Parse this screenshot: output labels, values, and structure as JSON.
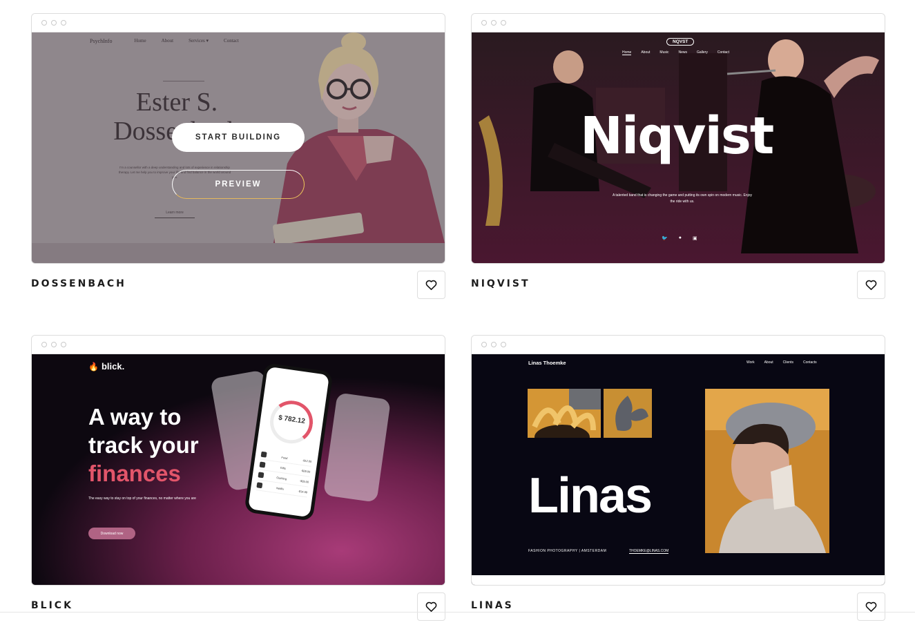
{
  "hover_actions": {
    "start_label": "START BUILDING",
    "preview_label": "PREVIEW"
  },
  "cards": [
    {
      "title": "DOSSENBACH",
      "preview": {
        "logo": "PsychInfo",
        "nav": [
          "Home",
          "About",
          "Services ▾",
          "Contact"
        ],
        "name_line1": "Ester S.",
        "name_line2": "Dossenbach",
        "blurb": "I'm a counsellor with a deep understanding and lots of experience in relationship therapy. Let me help you to improve your life and find balance in the world around you.",
        "link": "Learn more"
      }
    },
    {
      "title": "NIQVIST",
      "preview": {
        "badge": "NQVST",
        "nav": [
          "Home",
          "About",
          "Music",
          "News",
          "Gallery",
          "Contact"
        ],
        "title": "Niqvist",
        "tagline": "A talented band that is changing the game and putting its own spin on modern music. Enjoy the ride with us.",
        "social_icons": [
          "twitter-icon",
          "facebook-icon",
          "instagram-icon"
        ]
      }
    },
    {
      "title": "BLICK",
      "preview": {
        "logo": "blick.",
        "headline_1": "A way to",
        "headline_2": "track your",
        "headline_accent": "finances",
        "sub": "The easy way to stay on top of your finances, no matter where you are",
        "cta": "Download now",
        "phone_amount": "$ 782.12",
        "phone_rows": [
          {
            "label": "Food",
            "value": "-$12.00"
          },
          {
            "label": "Gifts",
            "value": "-$28.00"
          },
          {
            "label": "Clothing",
            "value": "-$35.00"
          },
          {
            "label": "Netflix",
            "value": "-$14.99"
          }
        ]
      }
    },
    {
      "title": "LINAS",
      "preview": {
        "brand": "Linas Thoemke",
        "nav": [
          "Work",
          "About",
          "Clients",
          "Contacts"
        ],
        "big": "Linas",
        "caption": "FASHION PHOTOGRAPHY | AMSTERDAM",
        "email": "THOEMKE@LINAS.COM"
      }
    }
  ]
}
